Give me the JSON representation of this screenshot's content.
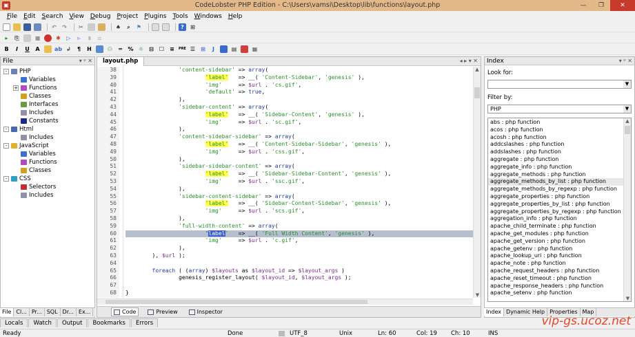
{
  "window": {
    "title": "CodeLobster PHP Edition - C:\\Users\\vamsi\\Desktop\\lib\\functions\\layout.php"
  },
  "menu": [
    "File",
    "Edit",
    "Search",
    "View",
    "Debug",
    "Project",
    "Plugins",
    "Tools",
    "Windows",
    "Help"
  ],
  "file_panel": {
    "title": "File",
    "tree": [
      {
        "label": "PHP",
        "level": 0,
        "exp": "-",
        "icon": "#6a7fb8"
      },
      {
        "label": "Variables",
        "level": 1,
        "icon": "#3b6fd0"
      },
      {
        "label": "Functions",
        "level": 1,
        "exp": "+",
        "icon": "#b04ac0"
      },
      {
        "label": "Classes",
        "level": 1,
        "icon": "#d0a020"
      },
      {
        "label": "Interfaces",
        "level": 1,
        "icon": "#6a9a40"
      },
      {
        "label": "Includes",
        "level": 1,
        "icon": "#9090a8"
      },
      {
        "label": "Constants",
        "level": 1,
        "icon": "#1a2a8a"
      },
      {
        "label": "Html",
        "level": 0,
        "exp": "-",
        "icon": "#4a6ab0"
      },
      {
        "label": "Includes",
        "level": 1,
        "icon": "#9090a8"
      },
      {
        "label": "JavaScript",
        "level": 0,
        "exp": "-",
        "icon": "#e0b030"
      },
      {
        "label": "Variables",
        "level": 1,
        "icon": "#3b6fd0"
      },
      {
        "label": "Functions",
        "level": 1,
        "icon": "#b04ac0"
      },
      {
        "label": "Classes",
        "level": 1,
        "icon": "#d0a020"
      },
      {
        "label": "CSS",
        "level": 0,
        "exp": "-",
        "icon": "#30a0c0"
      },
      {
        "label": "Selectors",
        "level": 1,
        "icon": "#c03030"
      },
      {
        "label": "Includes",
        "level": 1,
        "icon": "#9090a8"
      }
    ],
    "tabs": [
      "File",
      "Cl...",
      "Pr...",
      "SQL",
      "Dr...",
      "Ex..."
    ]
  },
  "editor": {
    "tab": "layout.php",
    "view_tabs": [
      "Code",
      "Preview",
      "Inspector"
    ],
    "lines": [
      {
        "n": "38",
        "segs": [
          [
            "                ",
            ""
          ],
          [
            "'content-sidebar'",
            "str"
          ],
          [
            " => ",
            ""
          ],
          [
            "array",
            "kw"
          ],
          [
            "(",
            ""
          ]
        ]
      },
      {
        "n": "39",
        "segs": [
          [
            "                        ",
            ""
          ],
          [
            "'label'",
            "str hl"
          ],
          [
            "   => __( ",
            ""
          ],
          [
            "'Content-Sidebar'",
            "str"
          ],
          [
            ", ",
            ""
          ],
          [
            "'genesis'",
            "str"
          ],
          [
            " ),",
            ""
          ]
        ]
      },
      {
        "n": "40",
        "segs": [
          [
            "                        ",
            ""
          ],
          [
            "'img'",
            "str"
          ],
          [
            "     => ",
            ""
          ],
          [
            "$url",
            "var"
          ],
          [
            " . ",
            ""
          ],
          [
            "'cs.gif'",
            "str"
          ],
          [
            ",",
            ""
          ]
        ]
      },
      {
        "n": "41",
        "segs": [
          [
            "                        ",
            ""
          ],
          [
            "'default'",
            "str"
          ],
          [
            " => ",
            ""
          ],
          [
            "true",
            "kw"
          ],
          [
            ",",
            ""
          ]
        ]
      },
      {
        "n": "42",
        "segs": [
          [
            "                ),",
            ""
          ]
        ]
      },
      {
        "n": "43",
        "segs": [
          [
            "                ",
            ""
          ],
          [
            "'sidebar-content'",
            "str"
          ],
          [
            " => ",
            ""
          ],
          [
            "array",
            "kw"
          ],
          [
            "(",
            ""
          ]
        ]
      },
      {
        "n": "44",
        "segs": [
          [
            "                        ",
            ""
          ],
          [
            "'label'",
            "str hl"
          ],
          [
            "   => __( ",
            ""
          ],
          [
            "'Sidebar-Content'",
            "str"
          ],
          [
            ", ",
            ""
          ],
          [
            "'genesis'",
            "str"
          ],
          [
            " ),",
            ""
          ]
        ]
      },
      {
        "n": "45",
        "segs": [
          [
            "                        ",
            ""
          ],
          [
            "'img'",
            "str"
          ],
          [
            "     => ",
            ""
          ],
          [
            "$url",
            "var"
          ],
          [
            " . ",
            ""
          ],
          [
            "'sc.gif'",
            "str"
          ],
          [
            ",",
            ""
          ]
        ]
      },
      {
        "n": "46",
        "segs": [
          [
            "                ),",
            ""
          ]
        ]
      },
      {
        "n": "47",
        "segs": [
          [
            "                ",
            ""
          ],
          [
            "'content-sidebar-sidebar'",
            "str"
          ],
          [
            " => ",
            ""
          ],
          [
            "array",
            "kw"
          ],
          [
            "(",
            ""
          ]
        ]
      },
      {
        "n": "48",
        "segs": [
          [
            "                        ",
            ""
          ],
          [
            "'label'",
            "str hl"
          ],
          [
            "   => __( ",
            ""
          ],
          [
            "'Content-Sidebar-Sidebar'",
            "str"
          ],
          [
            ", ",
            ""
          ],
          [
            "'genesis'",
            "str"
          ],
          [
            " ),",
            ""
          ]
        ]
      },
      {
        "n": "49",
        "segs": [
          [
            "                        ",
            ""
          ],
          [
            "'img'",
            "str"
          ],
          [
            "     => ",
            ""
          ],
          [
            "$url",
            "var"
          ],
          [
            " . ",
            ""
          ],
          [
            "'css.gif'",
            "str"
          ],
          [
            ",",
            ""
          ]
        ]
      },
      {
        "n": "50",
        "segs": [
          [
            "                ),",
            ""
          ]
        ]
      },
      {
        "n": "51",
        "segs": [
          [
            "                ",
            ""
          ],
          [
            "'sidebar-sidebar-content'",
            "str"
          ],
          [
            " => ",
            ""
          ],
          [
            "array",
            "kw"
          ],
          [
            "(",
            ""
          ]
        ]
      },
      {
        "n": "52",
        "segs": [
          [
            "                        ",
            ""
          ],
          [
            "'label'",
            "str hl"
          ],
          [
            "   => __( ",
            ""
          ],
          [
            "'Sidebar-Sidebar-Content'",
            "str"
          ],
          [
            ", ",
            ""
          ],
          [
            "'genesis'",
            "str"
          ],
          [
            " ),",
            ""
          ]
        ]
      },
      {
        "n": "53",
        "segs": [
          [
            "                        ",
            ""
          ],
          [
            "'img'",
            "str"
          ],
          [
            "     => ",
            ""
          ],
          [
            "$url",
            "var"
          ],
          [
            " . ",
            ""
          ],
          [
            "'ssc.gif'",
            "str"
          ],
          [
            ",",
            ""
          ]
        ]
      },
      {
        "n": "54",
        "segs": [
          [
            "                ),",
            ""
          ]
        ]
      },
      {
        "n": "55",
        "segs": [
          [
            "                ",
            ""
          ],
          [
            "'sidebar-content-sidebar'",
            "str"
          ],
          [
            " => ",
            ""
          ],
          [
            "array",
            "kw"
          ],
          [
            "(",
            ""
          ]
        ]
      },
      {
        "n": "56",
        "segs": [
          [
            "                        ",
            ""
          ],
          [
            "'label'",
            "str hl"
          ],
          [
            "   => __( ",
            ""
          ],
          [
            "'Sidebar-Content-Sidebar'",
            "str"
          ],
          [
            ", ",
            ""
          ],
          [
            "'genesis'",
            "str"
          ],
          [
            " ),",
            ""
          ]
        ]
      },
      {
        "n": "57",
        "segs": [
          [
            "                        ",
            ""
          ],
          [
            "'img'",
            "str"
          ],
          [
            "     => ",
            ""
          ],
          [
            "$url",
            "var"
          ],
          [
            " . ",
            ""
          ],
          [
            "'scs.gif'",
            "str"
          ],
          [
            ",",
            ""
          ]
        ]
      },
      {
        "n": "58",
        "segs": [
          [
            "                ),",
            ""
          ]
        ]
      },
      {
        "n": "59",
        "segs": [
          [
            "                ",
            ""
          ],
          [
            "'full-width-content'",
            "str"
          ],
          [
            " => ",
            ""
          ],
          [
            "array",
            "kw"
          ],
          [
            "(",
            ""
          ]
        ]
      },
      {
        "n": "60",
        "segs": [
          [
            "                        '",
            ""
          ],
          [
            "label",
            "selblk"
          ],
          [
            "'",
            "str"
          ],
          [
            "   => __( ",
            ""
          ],
          [
            "'Full Width Content'",
            "str"
          ],
          [
            ", ",
            ""
          ],
          [
            "'genesis'",
            "str"
          ],
          [
            " ),",
            ""
          ]
        ],
        "sel": true
      },
      {
        "n": "61",
        "segs": [
          [
            "                        ",
            ""
          ],
          [
            "'img'",
            "str"
          ],
          [
            "     => ",
            ""
          ],
          [
            "$url",
            "var"
          ],
          [
            " . ",
            ""
          ],
          [
            "'c.gif'",
            "str"
          ],
          [
            ",",
            ""
          ]
        ]
      },
      {
        "n": "62",
        "segs": [
          [
            "                ),",
            ""
          ]
        ]
      },
      {
        "n": "63",
        "segs": [
          [
            "        ), ",
            ""
          ],
          [
            "$url",
            "var"
          ],
          [
            " );",
            ""
          ]
        ]
      },
      {
        "n": "64",
        "segs": [
          [
            "",
            ""
          ]
        ]
      },
      {
        "n": "65",
        "segs": [
          [
            "        ",
            ""
          ],
          [
            "foreach",
            "kw"
          ],
          [
            " ( (",
            ""
          ],
          [
            "array",
            "kw"
          ],
          [
            ") ",
            ""
          ],
          [
            "$layouts",
            "var"
          ],
          [
            " as ",
            ""
          ],
          [
            "$layout_id",
            "var"
          ],
          [
            " => ",
            ""
          ],
          [
            "$layout_args",
            "var"
          ],
          [
            " )",
            ""
          ]
        ]
      },
      {
        "n": "66",
        "segs": [
          [
            "                genesis_register_layout( ",
            ""
          ],
          [
            "$layout_id",
            "var"
          ],
          [
            ", ",
            ""
          ],
          [
            "$layout_args",
            "var"
          ],
          [
            " );",
            ""
          ]
        ]
      },
      {
        "n": "67",
        "segs": [
          [
            "",
            ""
          ]
        ]
      },
      {
        "n": "68",
        "segs": [
          [
            "}",
            ""
          ]
        ]
      }
    ]
  },
  "index_panel": {
    "title": "Index",
    "look_for_label": "Look for:",
    "look_for_value": "",
    "filter_label": "Filter by:",
    "filter_value": "PHP",
    "items": [
      "abs : php function",
      "acos : php function",
      "acosh : php function",
      "addcslashes : php function",
      "addslashes : php function",
      "aggregate : php function",
      "aggregate_info : php function",
      "aggregate_methods : php function",
      "aggregate_methods_by_list : php function",
      "aggregate_methods_by_regexp : php function",
      "aggregate_properties : php function",
      "aggregate_properties_by_list : php function",
      "aggregate_properties_by_regexp : php function",
      "aggregation_info : php function",
      "apache_child_terminate : php function",
      "apache_get_modules : php function",
      "apache_get_version : php function",
      "apache_getenv : php function",
      "apache_lookup_uri : php function",
      "apache_note : php function",
      "apache_request_headers : php function",
      "apache_reset_timeout : php function",
      "apache_response_headers : php function",
      "apache_setenv : php function"
    ],
    "tabs": [
      "Index",
      "Dynamic Help",
      "Properties",
      "Map"
    ]
  },
  "output_tabs": [
    "Locals",
    "Watch",
    "Output",
    "Bookmarks",
    "Errors"
  ],
  "status": {
    "left": "Ready",
    "done": "Done",
    "encoding": "UTF_8",
    "eol": "Unix",
    "ln": "Ln: 60",
    "col": "Col: 19",
    "ch": "Ch: 10",
    "ins": "INS"
  },
  "watermark": "vip-gs.ucoz.net"
}
